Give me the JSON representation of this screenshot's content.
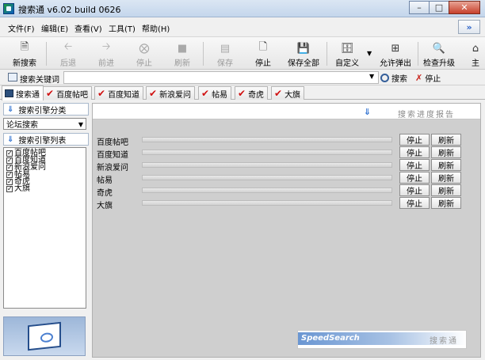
{
  "window": {
    "title": "搜索通 v6.02 build 0626"
  },
  "menu": [
    "文件(F)",
    "编辑(E)",
    "查看(V)",
    "工具(T)",
    "帮助(H)"
  ],
  "menu_overflow": "»",
  "toolbar": {
    "new_search": "新搜索",
    "back": "后退",
    "forward": "前进",
    "stop": "停止",
    "refresh": "刷新",
    "save": "保存",
    "stop2": "停止",
    "save_all": "保存全部",
    "custom": "自定义",
    "allow_popup": "允许弹出",
    "check_upgrade": "检查升级",
    "home_partial": "主"
  },
  "searchbar": {
    "label": "搜索关键词",
    "value": "",
    "search_btn": "搜索",
    "stop_btn": "停止"
  },
  "tabs": [
    {
      "label": "搜索通",
      "active": true
    },
    {
      "label": "百度帖吧",
      "active": false
    },
    {
      "label": "百度知道",
      "active": false
    },
    {
      "label": "新浪爱问",
      "active": false
    },
    {
      "label": "帖易",
      "active": false
    },
    {
      "label": "奇虎",
      "active": false
    },
    {
      "label": "大旗",
      "active": false
    }
  ],
  "left": {
    "category_header": "搜索引擎分类",
    "category_value": "论坛搜索",
    "list_header": "搜索引擎列表",
    "engines": [
      "百度帖吧",
      "百度知道",
      "新浪爱问",
      "帖易",
      "奇虎",
      "大旗"
    ]
  },
  "right": {
    "title": "搜索进度报告",
    "rows": [
      {
        "label": "百度帖吧",
        "progress": 0
      },
      {
        "label": "百度知道",
        "progress": 0
      },
      {
        "label": "新浪爱问",
        "progress": 0
      },
      {
        "label": "帖易",
        "progress": 0
      },
      {
        "label": "奇虎",
        "progress": 0
      },
      {
        "label": "大旗",
        "progress": 0
      }
    ],
    "stop_label": "停止",
    "refresh_label": "刷新",
    "brand_left": "SpeedSearch",
    "brand_right": "搜索通"
  }
}
